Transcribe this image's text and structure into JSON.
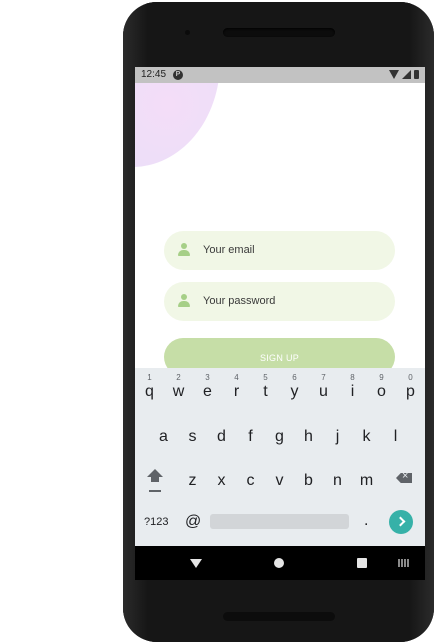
{
  "status_bar": {
    "time": "12:45",
    "notification_icon": "P"
  },
  "form": {
    "email_placeholder": "Your email",
    "password_placeholder": "Your password",
    "signup_label": "SIGN UP"
  },
  "keyboard": {
    "row1": [
      {
        "ch": "q",
        "hint": "1"
      },
      {
        "ch": "w",
        "hint": "2"
      },
      {
        "ch": "e",
        "hint": "3"
      },
      {
        "ch": "r",
        "hint": "4"
      },
      {
        "ch": "t",
        "hint": "5"
      },
      {
        "ch": "y",
        "hint": "6"
      },
      {
        "ch": "u",
        "hint": "7"
      },
      {
        "ch": "i",
        "hint": "8"
      },
      {
        "ch": "o",
        "hint": "9"
      },
      {
        "ch": "p",
        "hint": "0"
      }
    ],
    "row2": [
      "a",
      "s",
      "d",
      "f",
      "g",
      "h",
      "j",
      "k",
      "l"
    ],
    "row3": [
      "z",
      "x",
      "c",
      "v",
      "b",
      "n",
      "m"
    ],
    "symbols_label": "?123",
    "at_label": "@",
    "period_label": "."
  },
  "colors": {
    "field_bg": "#f1f7e6",
    "icon_green": "#a6cf87",
    "button_green": "#c6dea7",
    "enter_teal": "#36b1a8"
  }
}
